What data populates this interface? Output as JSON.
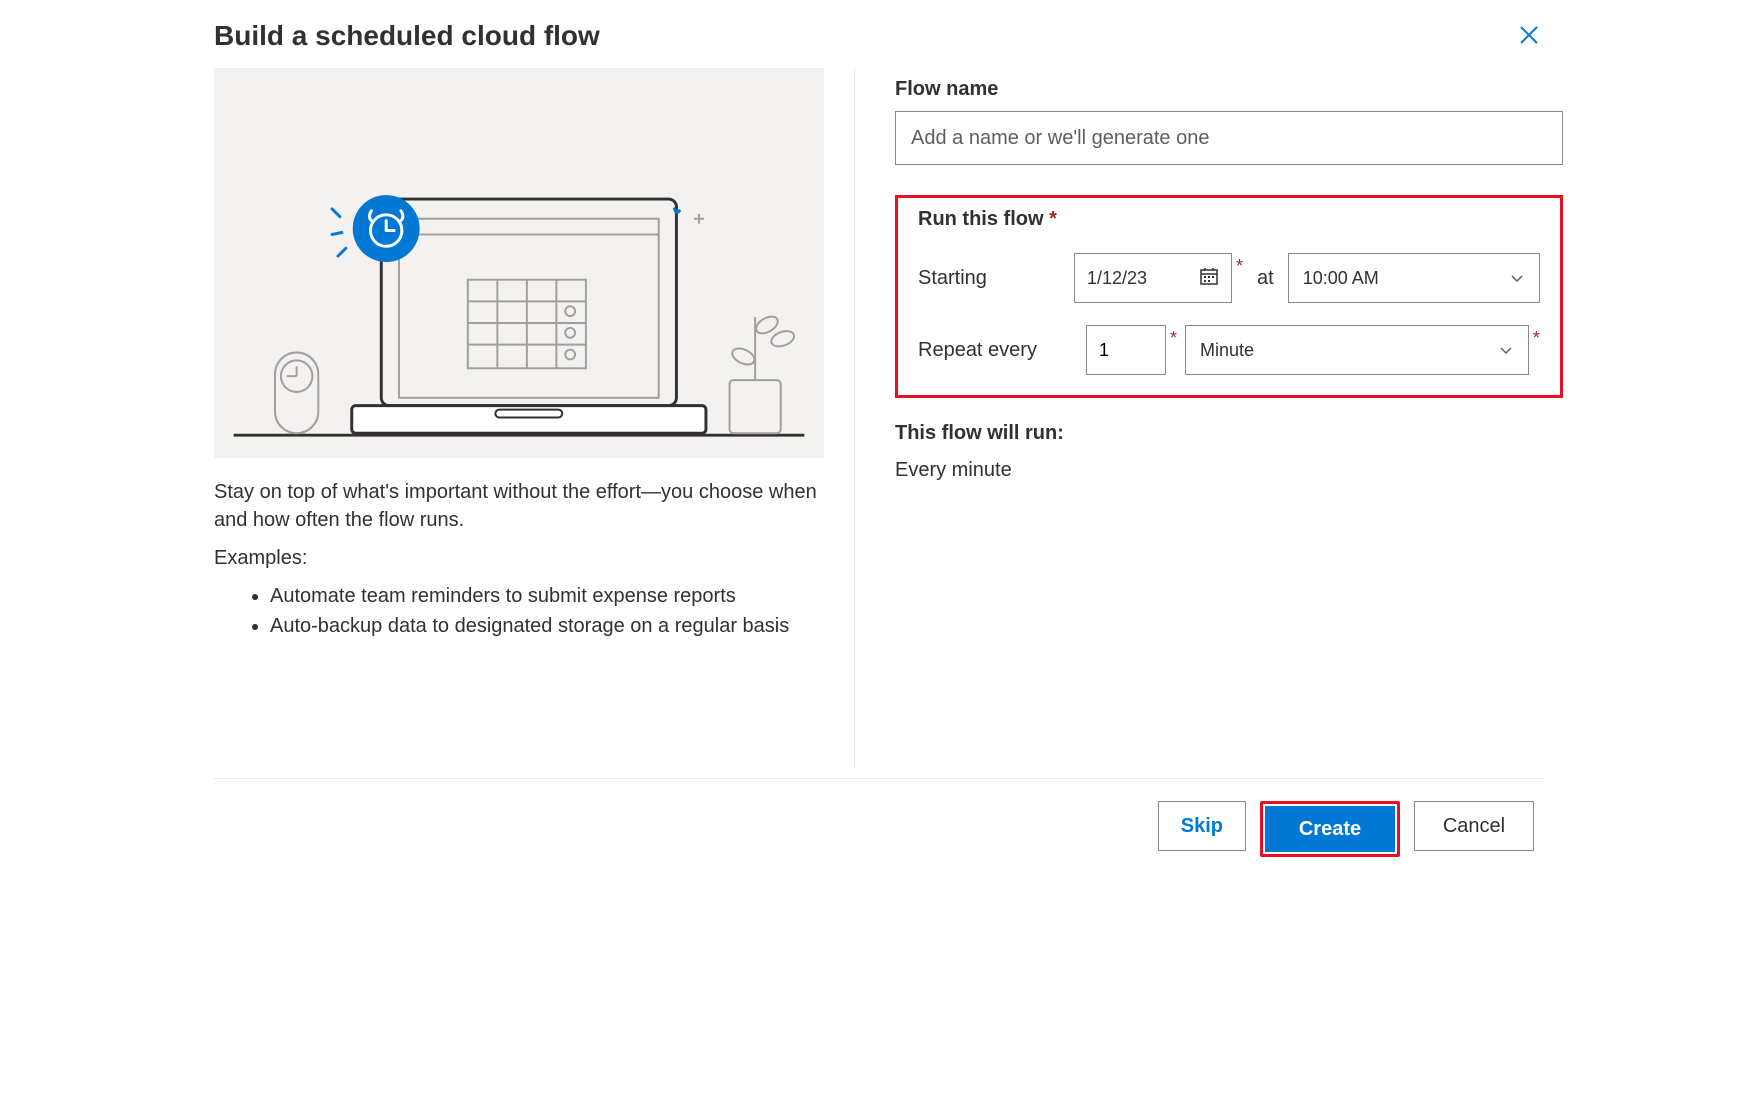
{
  "header": {
    "title": "Build a scheduled cloud flow"
  },
  "left": {
    "intro": "Stay on top of what's important without the effort—you choose when and how often the flow runs.",
    "examples_label": "Examples:",
    "examples": [
      "Automate team reminders to submit expense reports",
      "Auto-backup data to designated storage on a regular basis"
    ]
  },
  "form": {
    "flow_name_label": "Flow name",
    "flow_name_placeholder": "Add a name or we'll generate one",
    "flow_name_value": "",
    "run_label": "Run this flow",
    "starting_label": "Starting",
    "starting_date": "1/12/23",
    "at_label": "at",
    "starting_time": "10:00 AM",
    "repeat_label": "Repeat every",
    "repeat_value": "1",
    "repeat_unit": "Minute",
    "will_run_label": "This flow will run:",
    "will_run_value": "Every minute"
  },
  "buttons": {
    "skip": "Skip",
    "create": "Create",
    "cancel": "Cancel"
  }
}
